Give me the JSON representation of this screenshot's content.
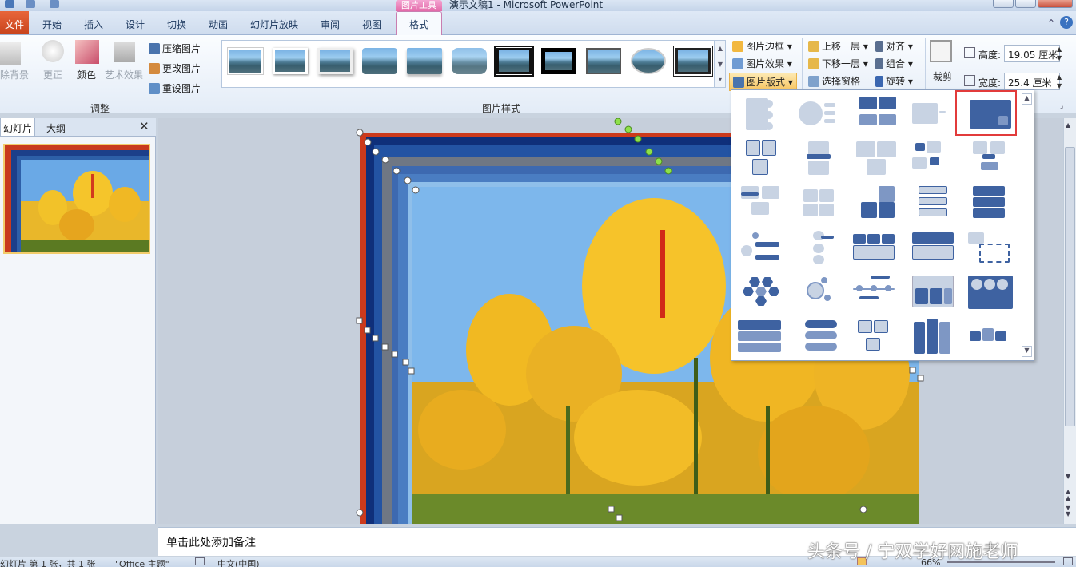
{
  "titlebar": {
    "title": "演示文稿1 - Microsoft PowerPoint",
    "context_group": "图片工具"
  },
  "tabs": [
    "开始",
    "插入",
    "设计",
    "切换",
    "动画",
    "幻灯片放映",
    "审阅",
    "视图"
  ],
  "file_tab": "文件",
  "active_tab": "格式",
  "ribbon": {
    "adjust": {
      "remove_bg": "除背景",
      "corrections": "更正",
      "color": "颜色",
      "artistic": "艺术效果",
      "compress": "压缩图片",
      "change": "更改图片",
      "reset": "重设图片",
      "group_label": "调整"
    },
    "styles": {
      "group_label": "图片样式",
      "border": "图片边框",
      "effects": "图片效果",
      "layout": "图片版式"
    },
    "arrange": {
      "bring_forward": "上移一层",
      "send_backward": "下移一层",
      "selection_pane": "选择窗格",
      "align": "对齐",
      "group": "组合",
      "rotate": "旋转"
    },
    "size": {
      "crop": "裁剪",
      "height_label": "高度:",
      "height_value": "19.05 厘米",
      "width_label": "宽度:",
      "width_value": "25.4 厘米"
    }
  },
  "left_panel": {
    "tab_slides": "幻灯片",
    "tab_outline": "大纲",
    "slide_number": "1"
  },
  "notes_placeholder": "单击此处添加备注",
  "status": {
    "slide_info": "幻灯片 第 1 张，共 1 张",
    "theme": "\"Office 主题\"",
    "language": "中文(中国)",
    "zoom": "66%"
  },
  "watermark": "头条号 / 宁双学好网施老师",
  "colors": {
    "accent_file": "#d5532a",
    "context_pink": "#e36aa8",
    "highlight": "#e23b3b",
    "smartart_dark": "#3e62a1"
  }
}
